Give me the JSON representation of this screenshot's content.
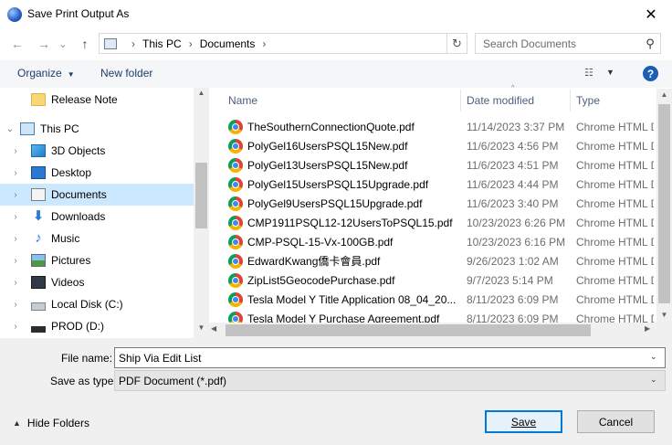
{
  "window": {
    "title": "Save Print Output As",
    "close_glyph": "✕"
  },
  "address": {
    "back_glyph": "←",
    "forward_glyph": "→",
    "recent_glyph": "⌄",
    "up_glyph": "↑",
    "crumbs": [
      "This PC",
      "Documents"
    ],
    "sep_glyph": "›",
    "refresh_glyph": "↻",
    "search_placeholder": "Search Documents",
    "search_glyph": "⚲"
  },
  "toolbar": {
    "organize_label": "Organize",
    "organize_arrow": "▼",
    "new_folder_label": "New folder",
    "view_glyph": "☷",
    "view_arrow": "▼",
    "help_glyph": "?"
  },
  "nav": {
    "chevron_collapsed": "›",
    "chevron_expanded": "⌄",
    "items": [
      {
        "label": "Release Note",
        "icon": "folder-icon"
      },
      {
        "label": "This PC",
        "icon": "pc-icon"
      },
      {
        "label": "3D Objects",
        "icon": "3d-objects-icon"
      },
      {
        "label": "Desktop",
        "icon": "desktop-icon"
      },
      {
        "label": "Documents",
        "icon": "documents-icon"
      },
      {
        "label": "Downloads",
        "icon": "downloads-icon"
      },
      {
        "label": "Music",
        "icon": "music-icon"
      },
      {
        "label": "Pictures",
        "icon": "pictures-icon"
      },
      {
        "label": "Videos",
        "icon": "videos-icon"
      },
      {
        "label": "Local Disk (C:)",
        "icon": "disk-icon"
      },
      {
        "label": "PROD (D:)",
        "icon": "drive-icon"
      }
    ],
    "down_glyph": "♪"
  },
  "files": {
    "columns": {
      "name": "Name",
      "date": "Date modified",
      "type": "Type"
    },
    "sort_glyph": "^",
    "rows": [
      {
        "name": "TheSouthernConnectionQuote.pdf",
        "date": "11/14/2023 3:37 PM",
        "type": "Chrome HTML D"
      },
      {
        "name": "PolyGel16UsersPSQL15New.pdf",
        "date": "11/6/2023 4:56 PM",
        "type": "Chrome HTML D"
      },
      {
        "name": "PolyGel13UsersPSQL15New.pdf",
        "date": "11/6/2023 4:51 PM",
        "type": "Chrome HTML D"
      },
      {
        "name": "PolyGel15UsersPSQL15Upgrade.pdf",
        "date": "11/6/2023 4:44 PM",
        "type": "Chrome HTML D"
      },
      {
        "name": "PolyGel9UsersPSQL15Upgrade.pdf",
        "date": "11/6/2023 3:40 PM",
        "type": "Chrome HTML D"
      },
      {
        "name": "CMP1911PSQL12-12UsersToPSQL15.pdf",
        "date": "10/23/2023 6:26 PM",
        "type": "Chrome HTML D"
      },
      {
        "name": "CMP-PSQL-15-Vx-100GB.pdf",
        "date": "10/23/2023 6:16 PM",
        "type": "Chrome HTML D"
      },
      {
        "name": "EdwardKwang僑卡會員.pdf",
        "date": "9/26/2023 1:02 AM",
        "type": "Chrome HTML D"
      },
      {
        "name": "ZipList5GeocodePurchase.pdf",
        "date": "9/7/2023 5:14 PM",
        "type": "Chrome HTML D"
      },
      {
        "name": "Tesla Model Y Title Application 08_04_20...",
        "date": "8/11/2023 6:09 PM",
        "type": "Chrome HTML D"
      },
      {
        "name": "Tesla Model Y Purchase Agreement.pdf",
        "date": "8/11/2023 6:09 PM",
        "type": "Chrome HTML D"
      }
    ]
  },
  "scroll": {
    "up": "▲",
    "down": "▼",
    "left": "◀",
    "right": "▶"
  },
  "form": {
    "file_name_label": "File name:",
    "file_name_value": "Ship Via Edit List",
    "save_type_label": "Save as type:",
    "save_type_value": "PDF Document (*.pdf)",
    "drop_glyph": "⌄"
  },
  "footer": {
    "hide_folders_label": "Hide Folders",
    "hide_folders_glyph": "▲",
    "save_label": "Save",
    "cancel_label": "Cancel"
  }
}
